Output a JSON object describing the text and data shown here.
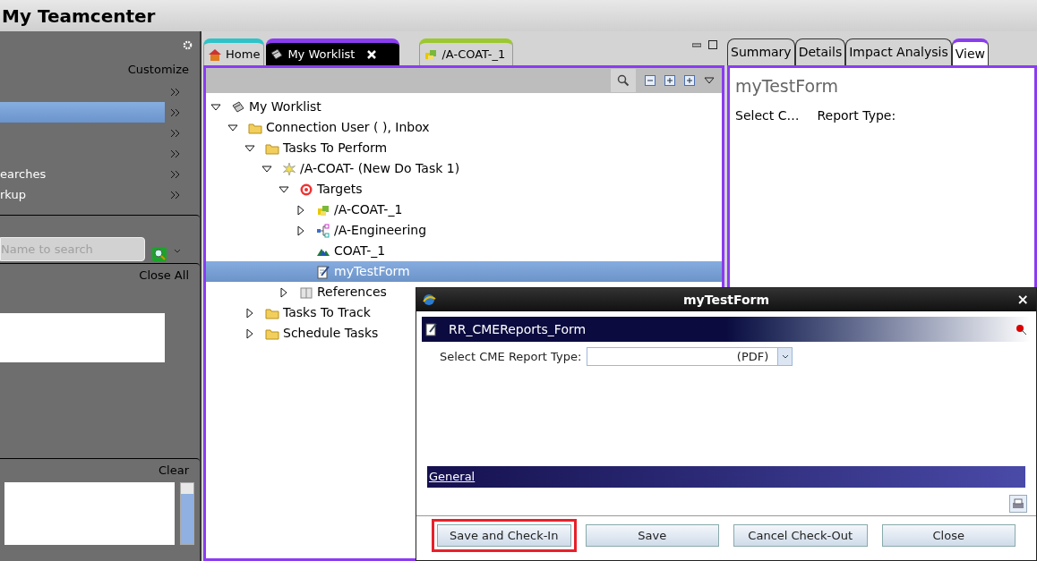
{
  "window": {
    "title": "My Teamcenter"
  },
  "left_panel": {
    "customize": "Customize",
    "items": [
      {
        "selected": false
      },
      {
        "selected": true
      },
      {
        "selected": false
      },
      {
        "selected": false
      },
      {
        "label": "earches",
        "selected": false
      },
      {
        "label": "rkup",
        "selected": false
      }
    ],
    "search": {
      "placeholder": "Name to search"
    },
    "close_all": "Close All",
    "clear": "Clear"
  },
  "editor_tabs": [
    {
      "label": "Home",
      "selected": false,
      "kind": "home"
    },
    {
      "label": "My Worklist",
      "selected": true,
      "kind": "worklist",
      "closable": true
    },
    {
      "label": "/A-COAT-_1",
      "selected": false,
      "kind": "item"
    }
  ],
  "tree": [
    {
      "label": "My Worklist",
      "kind": "worklist",
      "expanded": true,
      "selected": false,
      "children": [
        {
          "label": "Connection User ( ), Inbox",
          "kind": "folder",
          "expanded": true,
          "selected": false,
          "children": [
            {
              "label": "Tasks To Perform",
              "kind": "folder",
              "expanded": true,
              "selected": false,
              "children": [
                {
                  "label": "/A-COAT-  (New Do Task 1)",
                  "kind": "task",
                  "expanded": true,
                  "selected": false,
                  "children": [
                    {
                      "label": "Targets",
                      "kind": "target",
                      "expanded": true,
                      "selected": false,
                      "children": [
                        {
                          "label": "/A-COAT-_1",
                          "kind": "item",
                          "expanded": false,
                          "selected": false
                        },
                        {
                          "label": "/A-Engineering",
                          "kind": "structure",
                          "expanded": false,
                          "selected": false
                        },
                        {
                          "label": "COAT-_1",
                          "kind": "dataset",
                          "selected": false
                        },
                        {
                          "label": "myTestForm",
                          "kind": "form",
                          "selected": true
                        }
                      ]
                    },
                    {
                      "label": "References",
                      "kind": "book",
                      "expanded": false,
                      "selected": false
                    }
                  ]
                }
              ]
            },
            {
              "label": "Tasks To Track",
              "kind": "folder",
              "expanded": false,
              "selected": false
            },
            {
              "label": "Schedule Tasks",
              "kind": "folder",
              "expanded": false,
              "selected": false
            }
          ]
        }
      ]
    }
  ],
  "view_tabs": [
    {
      "label": "Summary",
      "selected": false
    },
    {
      "label": "Details",
      "selected": false
    },
    {
      "label": "Impact Analysis",
      "selected": false
    },
    {
      "label": "View",
      "selected": true
    }
  ],
  "view": {
    "title": "myTestForm",
    "fields": [
      "Select C…",
      "Report Type:"
    ]
  },
  "dialog": {
    "title": "myTestForm",
    "close": "×",
    "form_name": "RR_CMEReports_Form",
    "field_label": "Select CME Report Type:",
    "field_value": "(PDF)",
    "section": "General",
    "buttons": [
      {
        "label": "Save and Check-In",
        "highlighted": true
      },
      {
        "label": "Save",
        "highlighted": false
      },
      {
        "label": "Cancel Check-Out",
        "highlighted": false
      },
      {
        "label": "Close",
        "highlighted": false
      }
    ]
  }
}
